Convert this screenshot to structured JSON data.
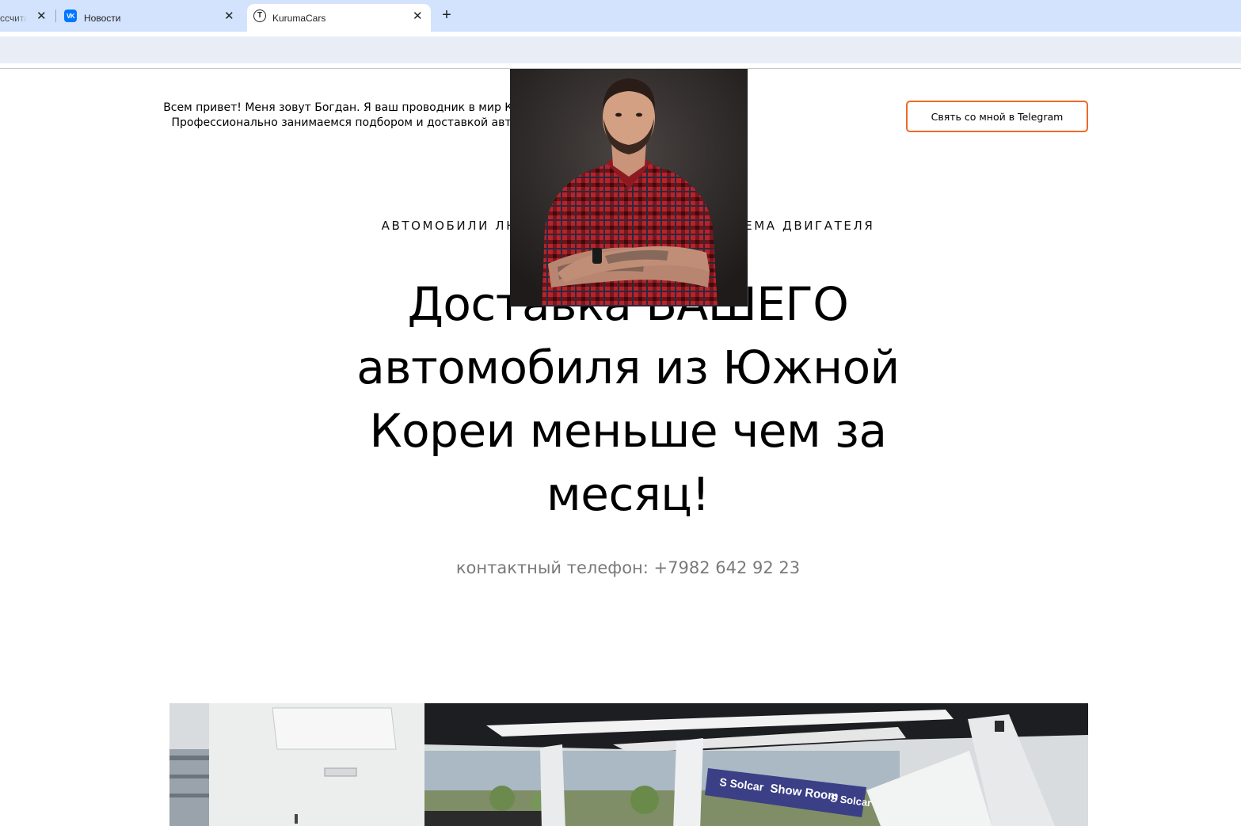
{
  "browser": {
    "tabs": [
      {
        "title": "ссчита",
        "active": false
      },
      {
        "title": "Новости",
        "active": false,
        "favicon": "vk-logo"
      },
      {
        "title": "KurumaCars",
        "active": true,
        "favicon": "tilda-logo"
      }
    ],
    "close_glyph": "✕",
    "new_tab_glyph": "+"
  },
  "page": {
    "intro": {
      "line1": "Всем привет! Меня зовут Богдан. Я ваш проводник в мир Ко",
      "line2": "Профессионально занимаемся подбором и доставкой авт"
    },
    "telegram_button_label": "Свять со мной в Telegram",
    "tagline": "АВТОМОБИЛИ ЛЮБОЙ КОМПЛЕКТАЦИИ И ОБЪЕМА ДВИГАТЕЛЯ",
    "headline": "Доставка ВАШЕГО автомобиля из Южной Кореи меньше чем за месяц!",
    "phone": "контактный телефон: +7982 642 92 23",
    "showroom_signage": [
      "S Solcar",
      "Show Room",
      "S Solcar"
    ],
    "accent_color": "#ee6a22"
  }
}
